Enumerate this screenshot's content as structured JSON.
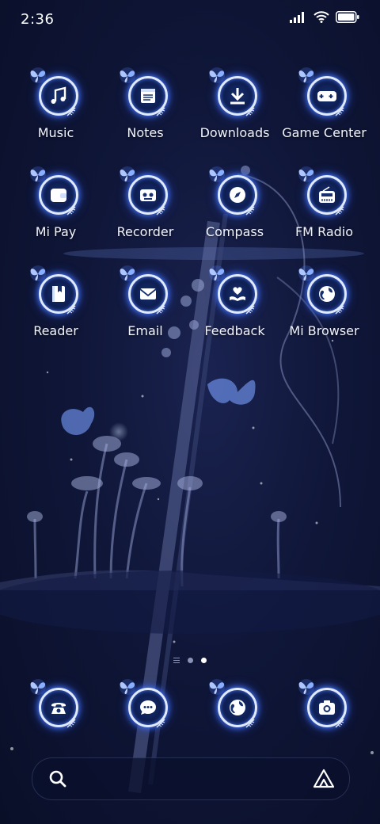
{
  "status_bar": {
    "time": "2:36"
  },
  "apps": [
    [
      {
        "id": "music",
        "label": "Music",
        "icon": "music-note-icon"
      },
      {
        "id": "notes",
        "label": "Notes",
        "icon": "notes-icon"
      },
      {
        "id": "downloads",
        "label": "Downloads",
        "icon": "download-icon"
      },
      {
        "id": "game-center",
        "label": "Game Center",
        "icon": "gamepad-icon"
      }
    ],
    [
      {
        "id": "mi-pay",
        "label": "Mi Pay",
        "icon": "wallet-icon"
      },
      {
        "id": "recorder",
        "label": "Recorder",
        "icon": "cassette-icon"
      },
      {
        "id": "compass",
        "label": "Compass",
        "icon": "compass-icon"
      },
      {
        "id": "fm-radio",
        "label": "FM Radio",
        "icon": "radio-icon"
      }
    ],
    [
      {
        "id": "reader",
        "label": "Reader",
        "icon": "book-icon"
      },
      {
        "id": "email",
        "label": "Email",
        "icon": "envelope-icon"
      },
      {
        "id": "feedback",
        "label": "Feedback",
        "icon": "heart-hand-icon"
      },
      {
        "id": "mi-browser",
        "label": "Mi Browser",
        "icon": "globe-icon"
      }
    ]
  ],
  "dock": [
    {
      "id": "phone",
      "icon": "telephone-icon"
    },
    {
      "id": "messages",
      "icon": "chat-bubble-icon"
    },
    {
      "id": "browser",
      "icon": "globe-icon"
    },
    {
      "id": "camera",
      "icon": "camera-icon"
    }
  ],
  "page_indicator": {
    "pages": 2,
    "current": 2
  },
  "colors": {
    "icon_glow": "#4b7dff",
    "ring": "#dfeaff",
    "background": "#0f1638"
  }
}
